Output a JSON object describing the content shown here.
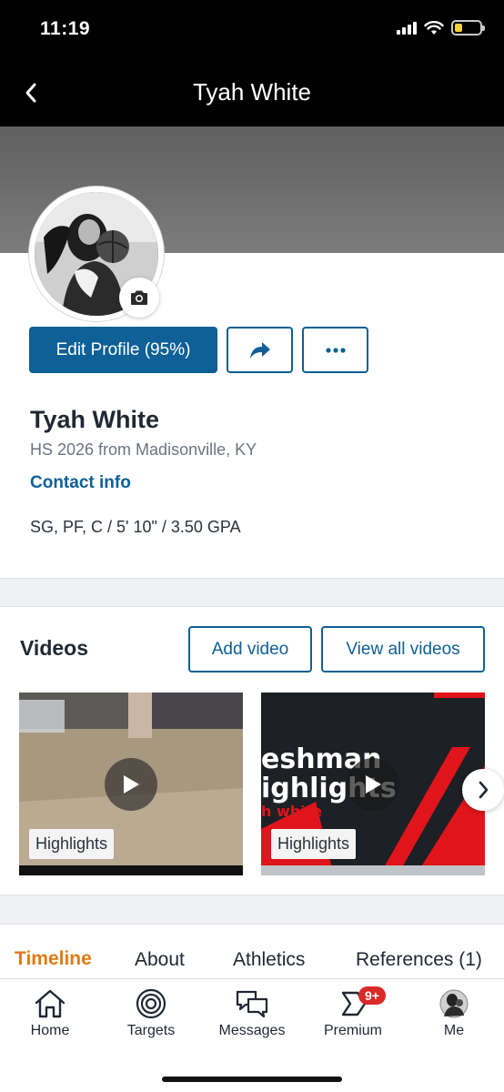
{
  "status_bar": {
    "time": "11:19"
  },
  "nav": {
    "title": "Tyah White",
    "back_icon": "chevron-left-icon"
  },
  "profile": {
    "name": "Tyah White",
    "class_line": "HS 2026 from Madisonville, KY",
    "contact_label": "Contact info",
    "stats_line": "SG, PF, C / 5' 10\" / 3.50 GPA",
    "edit_button_label": "Edit Profile (95%)"
  },
  "videos": {
    "title": "Videos",
    "add_label": "Add video",
    "view_all_label": "View all videos",
    "items": [
      {
        "tag": "Highlights"
      },
      {
        "tag": "Highlights",
        "thumb_text_1": "eshman",
        "thumb_text_2": "ighlights",
        "thumb_text_3": "h white"
      }
    ]
  },
  "tabs": [
    {
      "label": "Timeline",
      "active": true
    },
    {
      "label": "About",
      "active": false
    },
    {
      "label": "Athletics",
      "active": false
    },
    {
      "label": "References (1)",
      "active": false
    }
  ],
  "bottom_nav": [
    {
      "label": "Home",
      "icon": "home-icon"
    },
    {
      "label": "Targets",
      "icon": "target-icon"
    },
    {
      "label": "Messages",
      "icon": "messages-icon"
    },
    {
      "label": "Premium",
      "icon": "premium-icon",
      "badge": "9+"
    },
    {
      "label": "Me",
      "icon": "avatar"
    }
  ],
  "colors": {
    "brand": "#0e6096",
    "active_tab": "#e07b14",
    "badge": "#d92929"
  }
}
